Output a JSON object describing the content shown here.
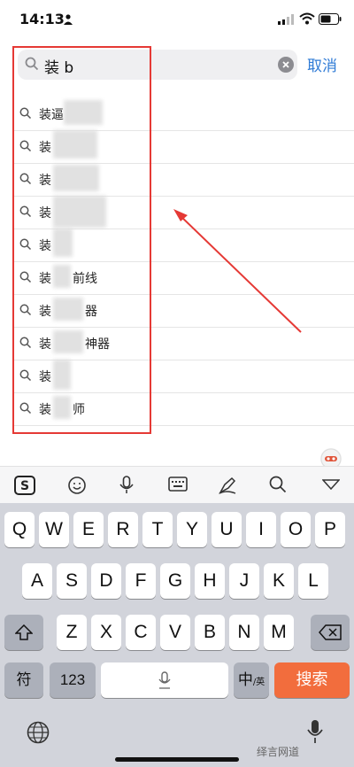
{
  "status": {
    "time": "14:13"
  },
  "search": {
    "query": "装 b",
    "cancel_label": "取消"
  },
  "suggestions": [
    {
      "text": "装逼",
      "tail": ""
    },
    {
      "text": "装",
      "tail": ""
    },
    {
      "text": "装",
      "tail": ""
    },
    {
      "text": "装",
      "tail": ""
    },
    {
      "text": "装",
      "tail": ""
    },
    {
      "text": "装",
      "tail": "前线"
    },
    {
      "text": "装",
      "tail": "器"
    },
    {
      "text": "装",
      "tail": "神器"
    },
    {
      "text": "装",
      "tail": ""
    },
    {
      "text": "装",
      "tail": "师"
    }
  ],
  "keyboard": {
    "row1": [
      "Q",
      "W",
      "E",
      "R",
      "T",
      "Y",
      "U",
      "I",
      "O",
      "P"
    ],
    "row2": [
      "A",
      "S",
      "D",
      "F",
      "G",
      "H",
      "J",
      "K",
      "L"
    ],
    "row3": [
      "Z",
      "X",
      "C",
      "V",
      "B",
      "N",
      "M"
    ],
    "symbols_label": "符",
    "numbers_label": "123",
    "lang_label": "中",
    "lang_sub": "/英",
    "search_label": "搜索"
  },
  "watermark": "绎言网道",
  "colors": {
    "accent": "#2f7bd6",
    "highlight": "#e53935",
    "search_key": "#f26d3d"
  }
}
